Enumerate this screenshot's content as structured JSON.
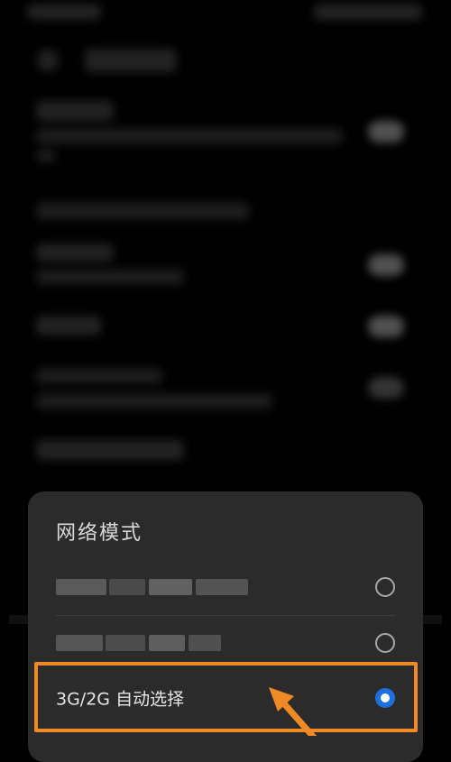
{
  "dialog": {
    "title": "网络模式",
    "options": [
      {
        "label": "",
        "selected": false
      },
      {
        "label": "",
        "selected": false
      },
      {
        "label": "3G/2G 自动选择",
        "selected": true
      }
    ]
  },
  "colors": {
    "accent": "#1f6fe0",
    "highlight": "#f08a24",
    "sheet": "#2b2b2b",
    "background": "#000000"
  },
  "icons": [
    "radio-unchecked-icon",
    "radio-checked-icon",
    "pointer-arrow-icon"
  ]
}
